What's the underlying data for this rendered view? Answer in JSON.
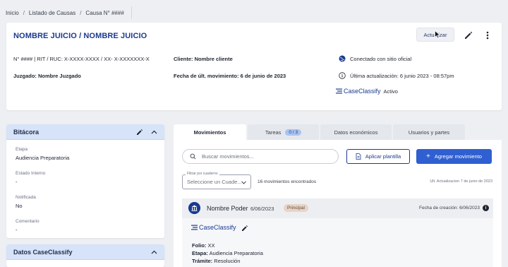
{
  "breadcrumb": {
    "items": [
      "Inicio",
      "Listado de Causas",
      "Causa N° ####"
    ],
    "separator": "/"
  },
  "header": {
    "title": "NOMBRE JUICIO / NOMBRE JUICIO",
    "actualizar_label": "Actualizar",
    "rit_ruc": "N° #### | RIT / RUC: X-XXXX-XXXX / XX- X-XXXXXXX-X",
    "juzgado_label": "Juzgado:",
    "juzgado_value": "Nombre Juzgado",
    "cliente_label": "Cliente:",
    "cliente_value": "Nombre cliente",
    "fecha_label": "Fecha de últ. movimiento:",
    "fecha_value": "6 de junio de 2023",
    "connected_text": "Conectado con sitio oficial",
    "last_update_text": "Última actualización: 6 junio 2023 - 08:57pm",
    "brand_name": "CaseClassify",
    "brand_status": "Activo"
  },
  "bitacora": {
    "title": "Bitácora",
    "fields": [
      {
        "label": "Etapa",
        "value": "Audiencia Preparatoria"
      },
      {
        "label": "Estado Interno",
        "value": "-"
      },
      {
        "label": "Notificada",
        "value": "No"
      },
      {
        "label": "Comentario",
        "value": "-"
      }
    ]
  },
  "datos_panel": {
    "title": "Datos CaseClassify"
  },
  "tabs": [
    {
      "label": "Movimientos",
      "active": true
    },
    {
      "label": "Tareas",
      "badge": "0 / 3"
    },
    {
      "label": "Datos económicos"
    },
    {
      "label": "Usuarios y partes"
    }
  ],
  "movimientos": {
    "search_placeholder": "Buscar movimientos...",
    "apply_template_label": "Aplicar plantilla",
    "add_label": "Agregar movimiento",
    "filter_label": "Filtrar por cuaderno",
    "select_placeholder": "Seleccione un Cuade...",
    "count_text": "16 movimientos encontrados",
    "updated_text": "Ult. Actualizacion 7 de junio de 2023",
    "item": {
      "name": "Nombre Poder",
      "date": "6/06/2023",
      "badge": "Principal",
      "created": "Fecha de creación: 6/06/2023",
      "brand": "CaseClassify",
      "folio_label": "Folio:",
      "folio_value": "XX",
      "etapa_label": "Etapa:",
      "etapa_value": "Audiencia Preparatoria",
      "tramite_label": "Trámite:",
      "tramite_value": "Resolución"
    }
  },
  "colors": {
    "brand_blue": "#1a3a8f",
    "primary_button": "#2f5fd0",
    "panel_header": "#d6e3f8"
  }
}
